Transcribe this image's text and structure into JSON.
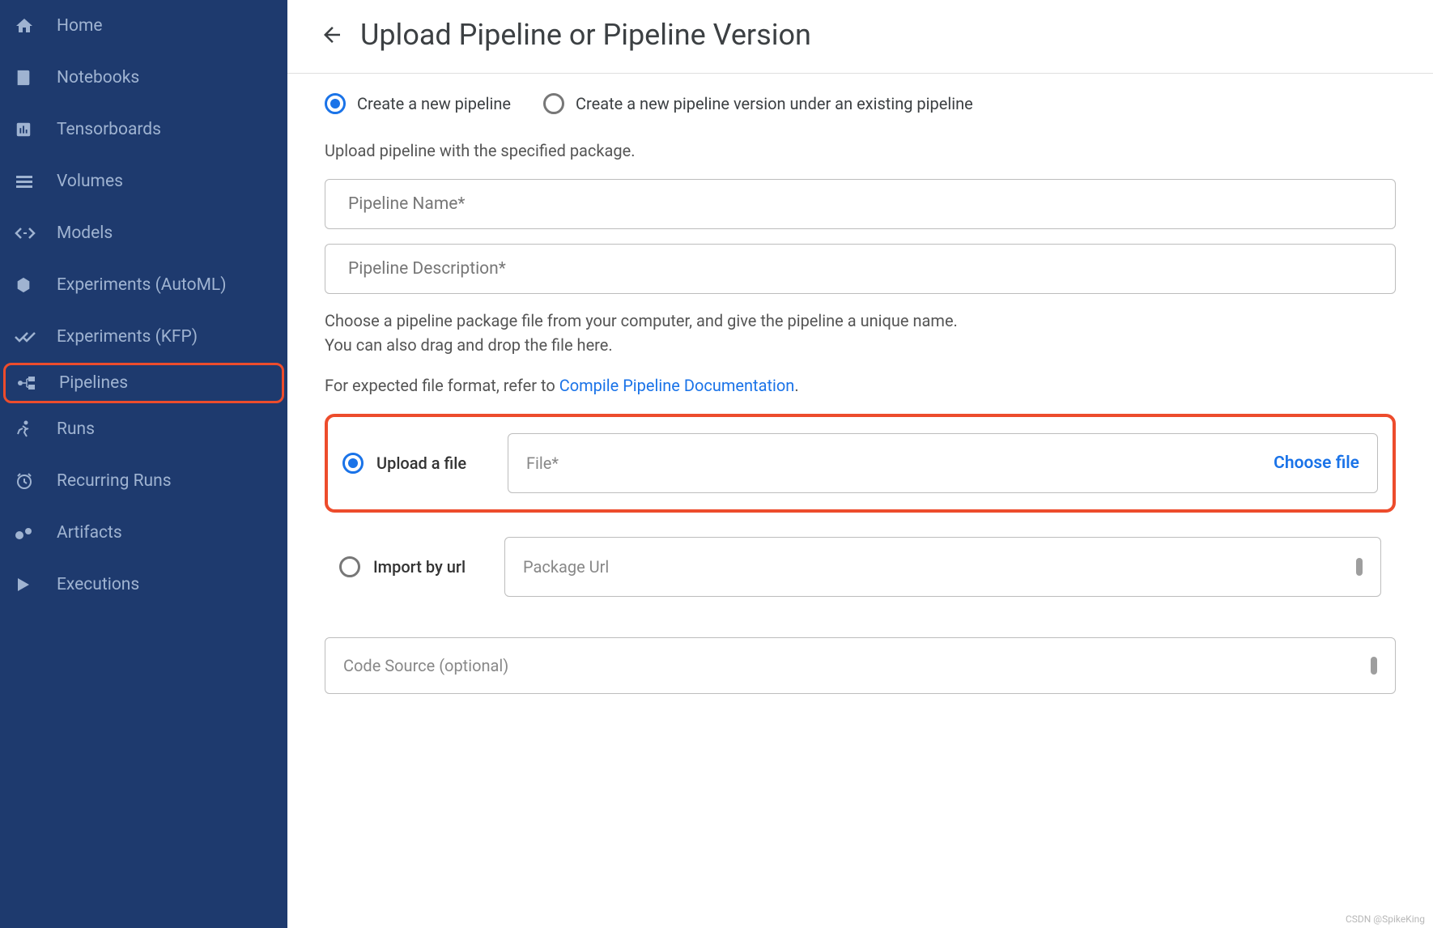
{
  "sidebar": {
    "items": [
      {
        "label": "Home",
        "icon": "home"
      },
      {
        "label": "Notebooks",
        "icon": "book"
      },
      {
        "label": "Tensorboards",
        "icon": "chart"
      },
      {
        "label": "Volumes",
        "icon": "menu"
      },
      {
        "label": "Models",
        "icon": "arrows"
      },
      {
        "label": "Experiments (AutoML)",
        "icon": "camera"
      },
      {
        "label": "Experiments (KFP)",
        "icon": "double-check"
      },
      {
        "label": "Pipelines",
        "icon": "flow"
      },
      {
        "label": "Runs",
        "icon": "run"
      },
      {
        "label": "Recurring Runs",
        "icon": "clock"
      },
      {
        "label": "Artifacts",
        "icon": "bubble"
      },
      {
        "label": "Executions",
        "icon": "play"
      }
    ]
  },
  "header": {
    "title": "Upload Pipeline or Pipeline Version"
  },
  "form": {
    "mode_options": {
      "create_new": "Create a new pipeline",
      "create_version": "Create a new pipeline version under an existing pipeline"
    },
    "upload_help": "Upload pipeline with the specified package.",
    "fields": {
      "name_label": "Pipeline Name*",
      "desc_label": "Pipeline Description*"
    },
    "choose_help_line1": "Choose a pipeline package file from your computer, and give the pipeline a unique name.",
    "choose_help_line2": "You can also drag and drop the file here.",
    "format_help_prefix": "For expected file format, refer to ",
    "format_help_link": "Compile Pipeline Documentation",
    "format_help_suffix": ".",
    "upload_file_label": "Upload a file",
    "file_placeholder": "File*",
    "choose_file_label": "Choose file",
    "import_url_label": "Import by url",
    "package_url_placeholder": "Package Url",
    "code_source_placeholder": "Code Source (optional)"
  },
  "watermark": "CSDN @SpikeKing"
}
